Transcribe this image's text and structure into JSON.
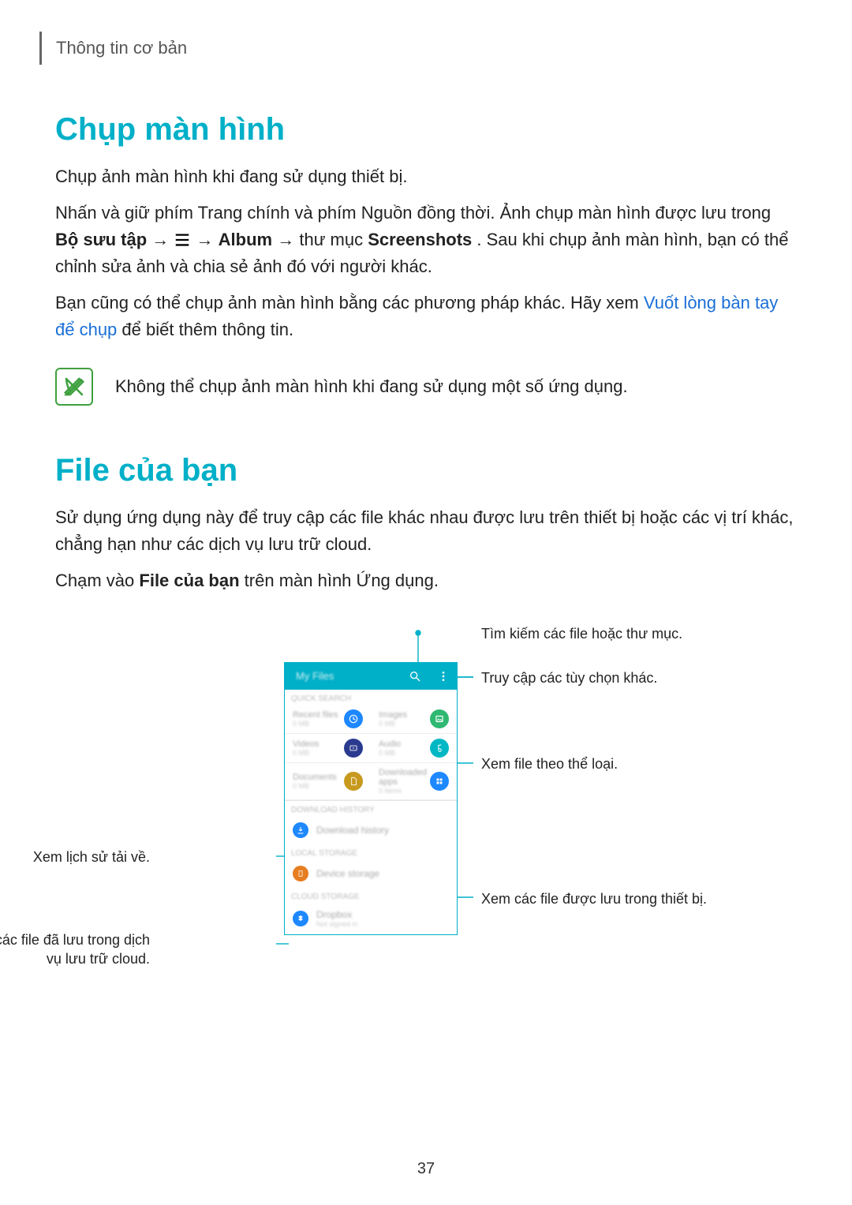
{
  "header": {
    "breadcrumb": "Thông tin cơ bản"
  },
  "section1": {
    "title": "Chụp màn hình",
    "p1": "Chụp ảnh màn hình khi đang sử dụng thiết bị.",
    "p2a": "Nhấn và giữ phím Trang chính và phím Nguồn đồng thời. Ảnh chụp màn hình được lưu trong ",
    "p2_bold1": "Bộ sưu tập",
    "p2_arrow1": " → ",
    "p2_arrow2": " → ",
    "p2_bold2": "Album",
    "p2_arrow3": " → thư mục ",
    "p2_bold3": "Screenshots",
    "p2b": ". Sau khi chụp ảnh màn hình, bạn có thể chỉnh sửa ảnh và chia sẻ ảnh đó với người khác.",
    "p3a": "Bạn cũng có thể chụp ảnh màn hình bằng các phương pháp khác. Hãy xem ",
    "p3_link": "Vuốt lòng bàn tay để chụp",
    "p3b": " để biết thêm thông tin.",
    "note": "Không thể chụp ảnh màn hình khi đang sử dụng một số ứng dụng."
  },
  "section2": {
    "title": "File của bạn",
    "p1": "Sử dụng ứng dụng này để truy cập các file khác nhau được lưu trên thiết bị hoặc các vị trí khác, chẳng hạn như các dịch vụ lưu trữ cloud.",
    "p2a": "Chạm vào ",
    "p2_bold": "File của bạn",
    "p2b": " trên màn hình Ứng dụng."
  },
  "phone": {
    "title": "My Files",
    "quick": "QUICK SEARCH",
    "cells": [
      {
        "name": "Recent files",
        "sub": "0 MB"
      },
      {
        "name": "Images",
        "sub": "0 MB"
      },
      {
        "name": "Videos",
        "sub": "0 MB"
      },
      {
        "name": "Audio",
        "sub": "0 MB"
      },
      {
        "name": "Documents",
        "sub": "0 MB"
      },
      {
        "name": "Downloaded apps",
        "sub": "0 items"
      }
    ],
    "download_hdr": "DOWNLOAD HISTORY",
    "download_item": "Download history",
    "local_hdr": "LOCAL STORAGE",
    "local_item": "Device storage",
    "cloud_hdr": "CLOUD STORAGE",
    "cloud_item": "Dropbox",
    "cloud_sub": "Not signed in"
  },
  "callouts": {
    "search": "Tìm kiếm các file hoặc thư mục.",
    "more": "Truy cập các tùy chọn khác.",
    "category": "Xem file theo thể loại.",
    "device": "Xem các file được lưu trong thiết bị.",
    "history": "Xem lịch sử tải về.",
    "cloud": "Xem các file đã lưu trong dịch vụ lưu trữ cloud."
  },
  "page_number": "37"
}
